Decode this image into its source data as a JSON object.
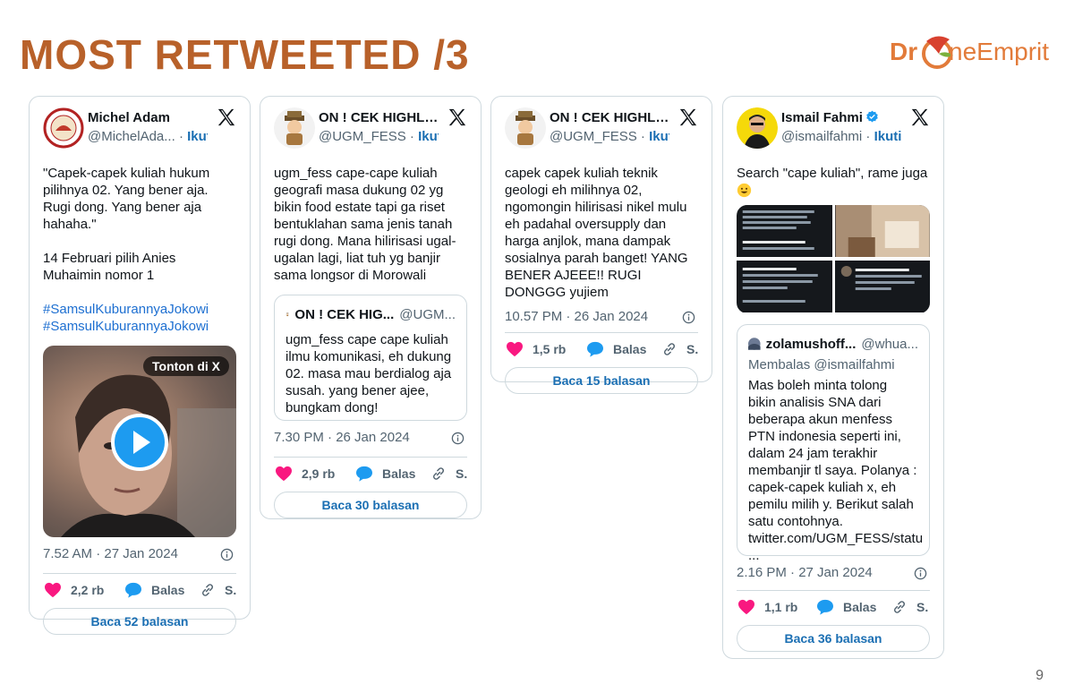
{
  "slide": {
    "title": "MOST RETWEETED /3",
    "brand_dr": "Dr",
    "brand_rest": "neEmprit",
    "page_number": "9"
  },
  "colors": {
    "accent": "#b8612a",
    "link": "#1b6fb3",
    "like": "#f91880",
    "reply": "#1d9bf0"
  },
  "tweets": [
    {
      "name": "Michel Adam",
      "handle": "@MichelAda...",
      "separator": "·",
      "follow": "Ikuti",
      "text": "\"Capek-capek kuliah hukum pilihnya 02. Yang bener aja. Rugi dong. Yang bener aja hahaha.\"\n\n14 Februari pilih Anies Muhaimin nomor 1",
      "hashtags": [
        "#SamsulKuburannyaJokowi",
        "#SamsulKuburannyaJokowi"
      ],
      "video_label": "Tonton di X",
      "timestamp": "7.52 AM · 27 Jan 2024",
      "likes": "2,2 rb",
      "reply_label": "Balas",
      "share_label": "S.",
      "replies_button": "Baca 52 balasan"
    },
    {
      "name": "ON ! CEK HIGHLI...",
      "handle": "@UGM_FESS",
      "separator": "·",
      "follow": "Ikuti",
      "text": "ugm_fess cape-cape kuliah geografi masa dukung 02 yg bikin food estate tapi ga riset bentuklahan sama jenis tanah rugi dong. Mana hilirisasi ugal-ugalan lagi, liat tuh yg banjir sama longsor di Morowali",
      "quote": {
        "name": "ON ! CEK HIG...",
        "handle": "@UGM...",
        "text": "ugm_fess cape cape kuliah ilmu komunikasi, eh dukung 02. masa mau berdialog aja susah. yang bener ajee, bungkam dong!"
      },
      "timestamp": "7.30 PM · 26 Jan 2024",
      "likes": "2,9 rb",
      "reply_label": "Balas",
      "share_label": "S.",
      "replies_button": "Baca 30 balasan"
    },
    {
      "name": "ON ! CEK HIGHLI...",
      "handle": "@UGM_FESS",
      "separator": "·",
      "follow": "Ikuti",
      "text": "capek capek kuliah teknik geologi eh milihnya 02, ngomongin hilirisasi nikel mulu eh padahal oversupply dan harga anjlok, mana dampak sosialnya parah banget! YANG BENER AJEEE!! RUGI DONGGG yujiem",
      "timestamp": "10.57 PM · 26 Jan 2024",
      "likes": "1,5 rb",
      "reply_label": "Balas",
      "share_label": "S.",
      "replies_button": "Baca 15 balasan"
    },
    {
      "name": "Ismail Fahmi",
      "handle": "@ismailfahmi",
      "separator": "·",
      "follow": "Ikuti",
      "text": "Search \"cape kuliah\", rame juga",
      "quote": {
        "name": "zolamushoff...",
        "handle": "@whua...",
        "reply_to": "Membalas @ismailfahmi",
        "text": "Mas boleh minta tolong bikin analisis SNA dari beberapa akun menfess PTN indonesia seperti ini, dalam 24 jam terakhir membanjir tl saya. Polanya : capek-capek kuliah x, eh pemilu milih y. Berikut salah satu contohnya. twitter.com/UGM_FESS/statu\n..."
      },
      "timestamp": "2.16 PM · 27 Jan 2024",
      "likes": "1,1 rb",
      "reply_label": "Balas",
      "share_label": "S.",
      "replies_button": "Baca 36 balasan"
    }
  ]
}
